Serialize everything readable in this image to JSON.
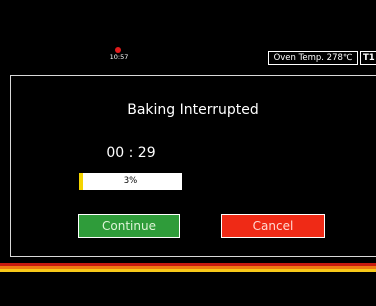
{
  "status_bar": {
    "time": "10:57",
    "oven_temp": "Oven Temp. 278℃",
    "timer_label": "T1"
  },
  "dialog": {
    "title": "Baking Interrupted",
    "countdown": "00 : 29",
    "progress": {
      "percent": 3,
      "label": "3%",
      "fill_color": "#f4d400"
    },
    "buttons": {
      "continue_label": "Continue",
      "continue_color": "#2f9c3a",
      "cancel_label": "Cancel",
      "cancel_color": "#ef2a16"
    }
  },
  "accent_stripes": [
    "#c81a0f",
    "#f07a12",
    "#f7c919"
  ],
  "status_indicator_color": "#e01b1b"
}
